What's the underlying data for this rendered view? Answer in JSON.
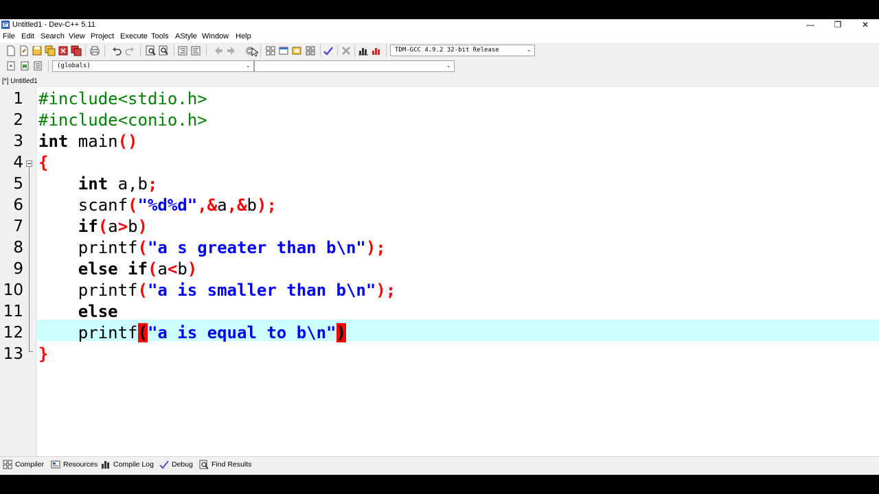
{
  "window": {
    "title": "Untitled1 - Dev-C++ 5.11",
    "minimize": "—",
    "maximize": "❐",
    "close": "✕"
  },
  "menu": [
    "File",
    "Edit",
    "Search",
    "View",
    "Project",
    "Execute",
    "Tools",
    "AStyle",
    "Window",
    "Help"
  ],
  "toolbar": {
    "compiler_select": "TDM-GCC 4.9.2 32-bit Release",
    "scope_select": "(globals)",
    "member_select": ""
  },
  "editor": {
    "tab_label": "[*] Untitled1",
    "line_numbers": [
      "1",
      "2",
      "3",
      "4",
      "5",
      "6",
      "7",
      "8",
      "9",
      "10",
      "11",
      "12",
      "13"
    ],
    "active_line": 12
  },
  "code": {
    "l1": "#include<stdio.h>",
    "l2": "#include<conio.h>",
    "l3_kw": "int",
    "l3_fn": " main",
    "l3_p": "()",
    "l4": "{",
    "l5_kw": "int",
    "l5_ids": " a,b",
    "l5_semi": ";",
    "l6_fn": "scanf",
    "l6_p1": "(",
    "l6_str": "\"%d%d\"",
    "l6_c": ",&",
    "l6_a": "a",
    "l6_c2": ",&",
    "l6_b": "b",
    "l6_end": ");",
    "l7_kw": "if",
    "l7_p1": "(",
    "l7_a": "a",
    "l7_op": ">",
    "l7_b": "b",
    "l7_p2": ")",
    "l8_fn": "printf",
    "l8_p1": "(",
    "l8_str": "\"a s greater than b\\n\"",
    "l8_end": ");",
    "l9_kw": "else if",
    "l9_p1": "(",
    "l9_a": "a",
    "l9_op": "<",
    "l9_b": "b",
    "l9_p2": ")",
    "l10_fn": "printf",
    "l10_p1": "(",
    "l10_str": "\"a is smaller than b\\n\"",
    "l10_end": ");",
    "l11_kw": "else",
    "l12_fn": "printf",
    "l12_p1": "(",
    "l12_str": "\"a is equal to b\\n\"",
    "l12_p2": ")",
    "l13": "}"
  },
  "bottom_tabs": [
    "Compiler",
    "Resources",
    "Compile Log",
    "Debug",
    "Find Results"
  ]
}
